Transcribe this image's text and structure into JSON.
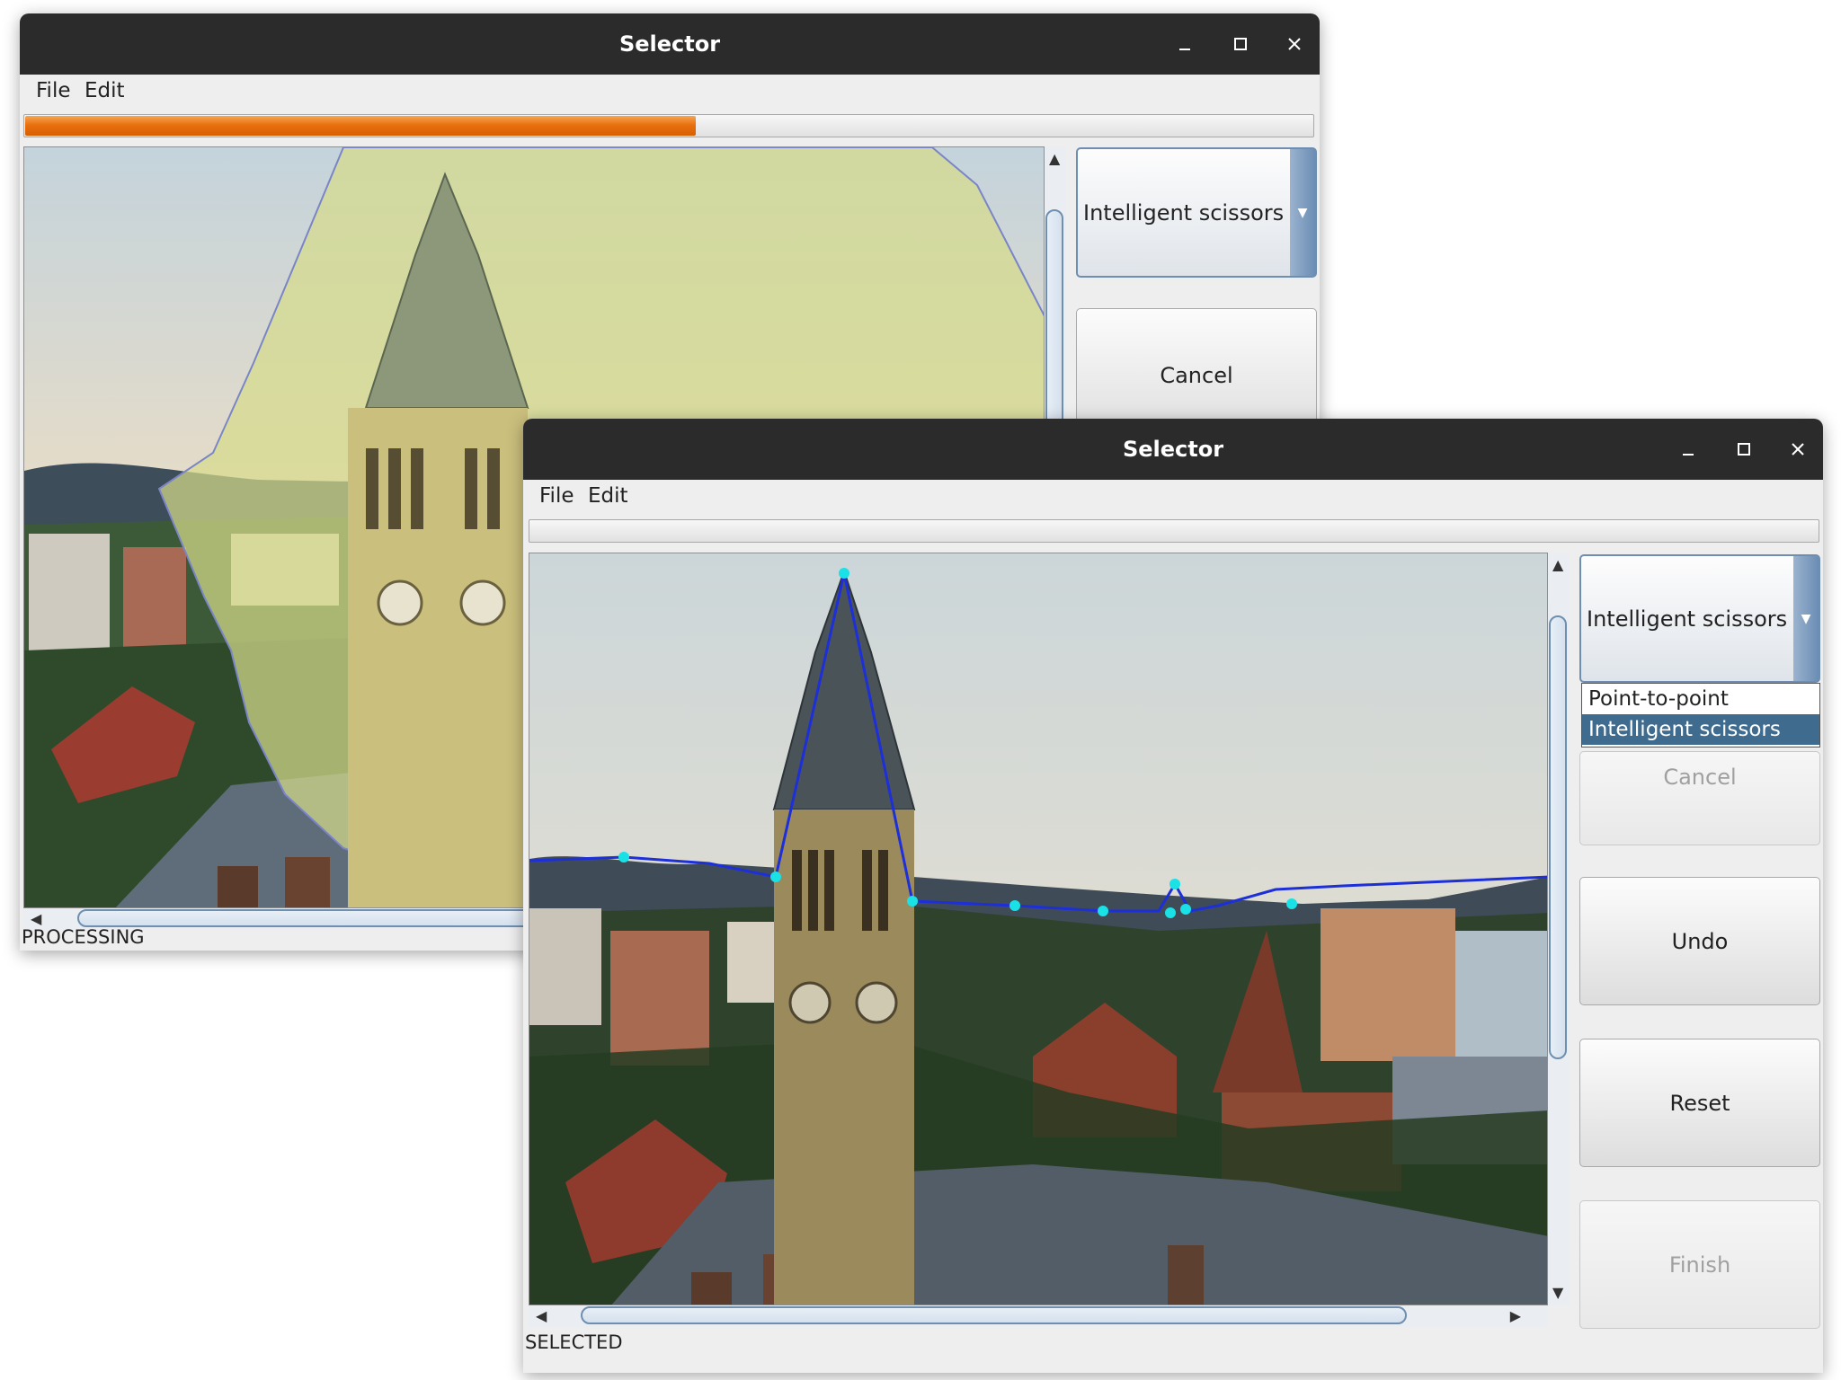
{
  "window1": {
    "title": "Selector",
    "menu": [
      "File",
      "Edit"
    ],
    "progress_fraction": 0.52,
    "mode_selected": "Intelligent scissors",
    "buttons": {
      "cancel": "Cancel"
    },
    "status": "PROCESSING"
  },
  "window2": {
    "title": "Selector",
    "menu": [
      "File",
      "Edit"
    ],
    "progress_fraction": 0,
    "mode_selected": "Intelligent scissors",
    "dropdown_options": [
      "Point-to-point",
      "Intelligent scissors"
    ],
    "dropdown_highlighted": "Intelligent scissors",
    "buttons": {
      "cancel": "Cancel",
      "undo": "Undo",
      "reset": "Reset",
      "finish": "Finish"
    },
    "status": "SELECTED"
  },
  "colors": {
    "title_bar": "#2b2b2b",
    "progress_orange": "#e9700f",
    "selection_fill": "#d6db8a",
    "contour": "#1d2fd8",
    "control_point": "#19e1e6",
    "combo_accent": "#6d8db1",
    "dropdown_selected": "#3f6b8f"
  },
  "icons": [
    "minimize-icon",
    "maximize-icon",
    "close-icon",
    "dropdown-arrow-icon",
    "scroll-up-icon",
    "scroll-down-icon",
    "scroll-left-icon",
    "scroll-right-icon"
  ]
}
